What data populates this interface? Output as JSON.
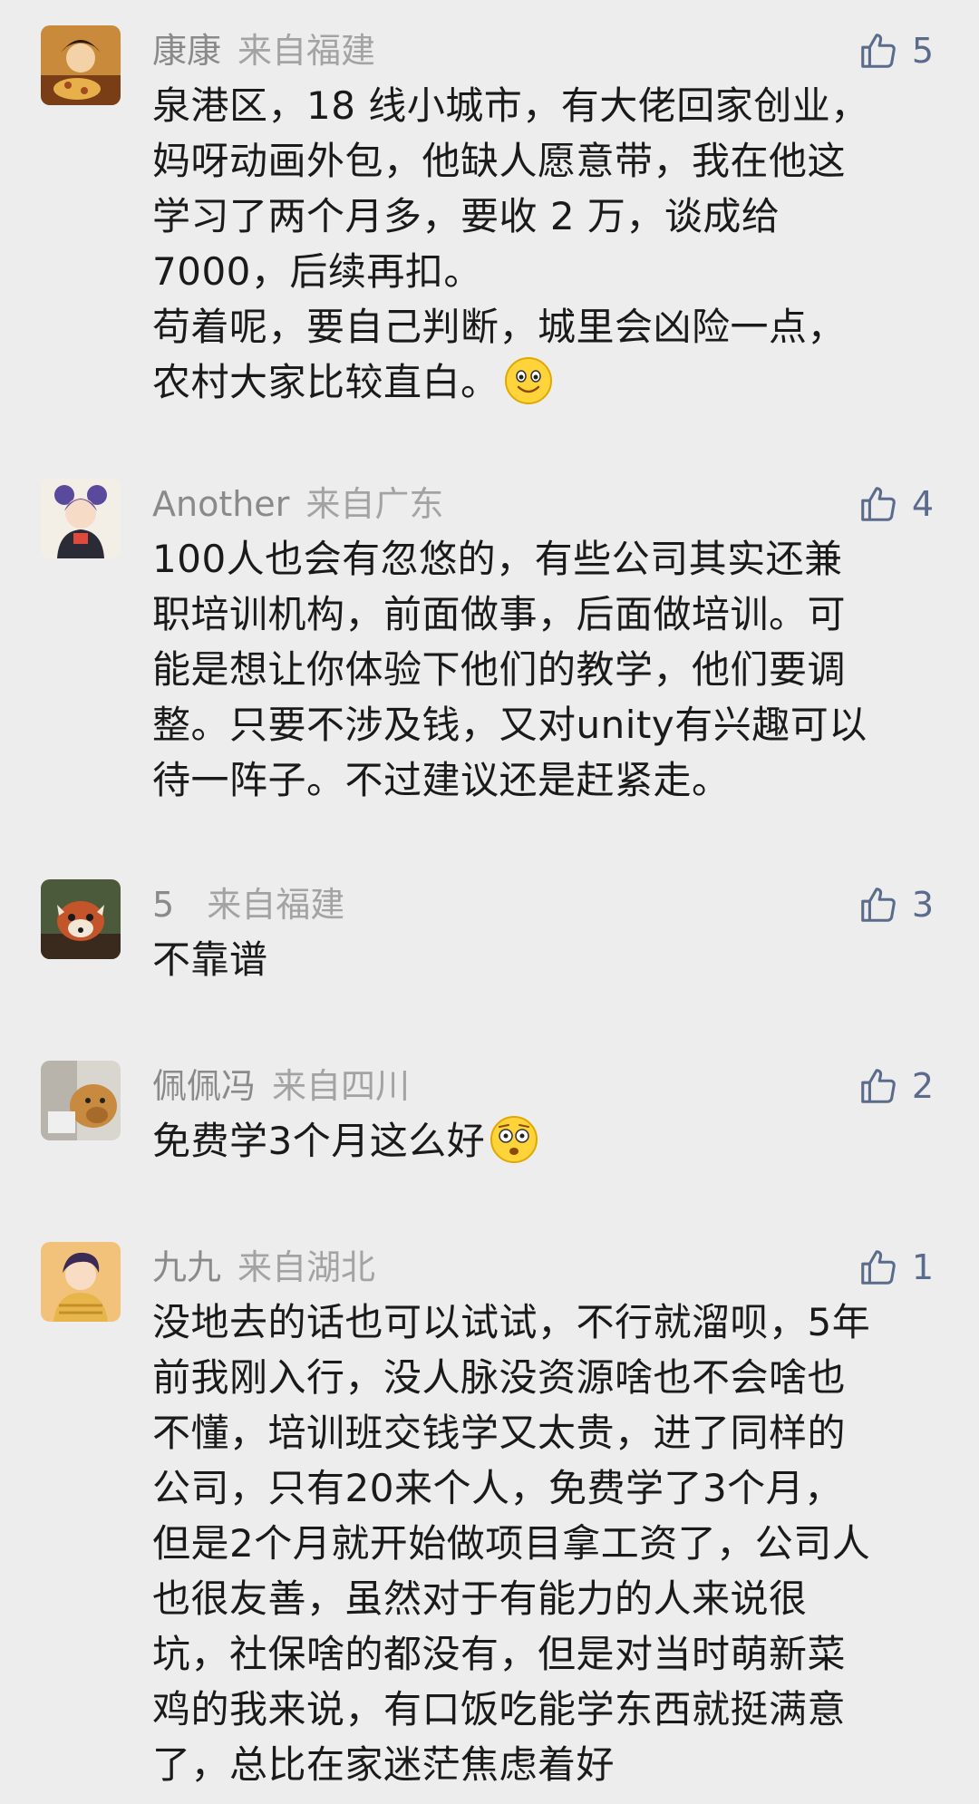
{
  "comments": [
    {
      "name": "康康",
      "location": "来自福建",
      "likes": "5",
      "lines": [
        "泉港区，18 线小城市，有大佬回家创业，",
        "妈呀动画外包，他缺人愿意带，我在他这",
        "学习了两个月多，要收 2 万，谈成给",
        "7000，后续再扣。",
        "苟着呢，要自己判断，城里会凶险一点，",
        "农村大家比较直白。"
      ]
    },
    {
      "name": "Another",
      "location": "来自广东",
      "likes": "4",
      "lines": [
        "100人也会有忽悠的，有些公司其实还兼",
        "职培训机构，前面做事，后面做培训。可",
        "能是想让你体验下他们的教学，他们要调",
        "整。只要不涉及钱，又对unity有兴趣可以",
        "待一阵子。不过建议还是赶紧走。"
      ]
    },
    {
      "name": "5",
      "location": "来自福建",
      "likes": "3",
      "lines": [
        "不靠谱"
      ]
    },
    {
      "name": "佩佩冯",
      "location": "来自四川",
      "likes": "2",
      "lines": [
        "免费学3个月这么好"
      ]
    },
    {
      "name": "九九",
      "location": "来自湖北",
      "likes": "1",
      "lines": [
        "没地去的话也可以试试，不行就溜呗，5年",
        "前我刚入行，没人脉没资源啥也不会啥也",
        "不懂，培训班交钱学又太贵，进了同样的",
        "公司，只有20来个人，免费学了3个月，",
        "但是2个月就开始做项目拿工资了，公司人",
        "也很友善，虽然对于有能力的人来说很",
        "坑，社保啥的都没有，但是对当时萌新菜",
        "鸡的我来说，有口饭吃能学东西就挺满意",
        "了，总比在家迷茫焦虑着好"
      ]
    }
  ],
  "icons": {
    "like": "thumbs-up-outline-icon",
    "emoji_smile": "smile-emoji-icon",
    "emoji_surprised": "surprised-emoji-icon"
  },
  "colors": {
    "background": "#ededed",
    "name": "#8a8a8a",
    "location": "#a3a3a3",
    "like": "#5b6b8c",
    "text": "#1a1a1a"
  }
}
